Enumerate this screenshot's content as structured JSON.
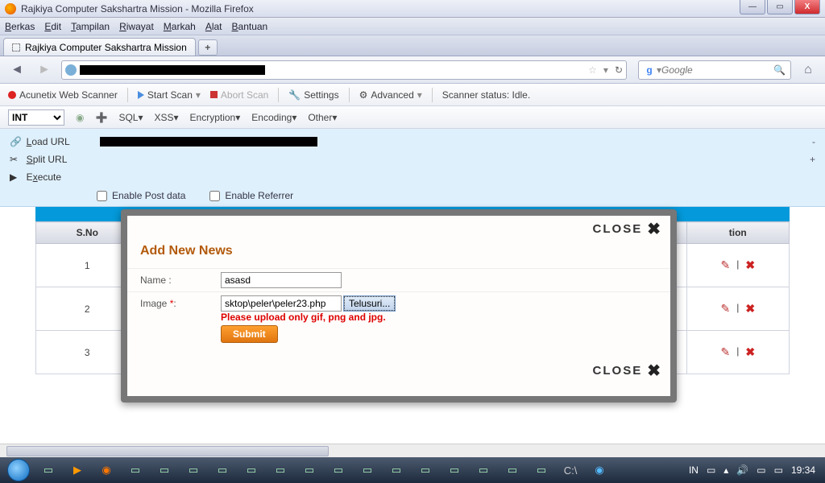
{
  "window": {
    "title": "Rajkiya Computer Sakshartra Mission - Mozilla Firefox"
  },
  "menu": {
    "berkas": "Berkas",
    "edit": "Edit",
    "tampilan": "Tampilan",
    "riwayat": "Riwayat",
    "markah": "Markah",
    "alat": "Alat",
    "bantuan": "Bantuan"
  },
  "tab": {
    "title": "Rajkiya Computer Sakshartra Mission"
  },
  "search": {
    "placeholder": "Google"
  },
  "acu": {
    "scanner": "Acunetix Web Scanner",
    "start": "Start Scan",
    "abort": "Abort Scan",
    "settings": "Settings",
    "advanced": "Advanced",
    "status": "Scanner status: Idle."
  },
  "tb2": {
    "int": "INT",
    "sql": "SQL",
    "xss": "XSS",
    "encryption": "Encryption",
    "encoding": "Encoding",
    "other": "Other"
  },
  "panel": {
    "load": "Load URL",
    "split": "Split URL",
    "execute": "Execute",
    "post": "Enable Post data",
    "ref": "Enable Referrer"
  },
  "table": {
    "sno": "S.No",
    "action": "tion",
    "r1": "1",
    "r2": "2",
    "r3": "3"
  },
  "modal": {
    "close": "CLOSE",
    "title": "Add New News",
    "name_label": "Name :",
    "name_value": "asasd",
    "image_label": "Image",
    "file_value": "sktop\\peler\\peler23.php",
    "browse": "Telusuri...",
    "warn": "Please upload only gif, png and jpg.",
    "submit": "Submit"
  },
  "clock": "19:34",
  "lang": "IN"
}
